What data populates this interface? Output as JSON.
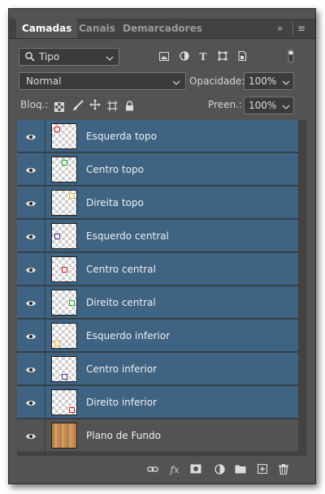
{
  "tabs": [
    {
      "label": "Camadas",
      "active": true
    },
    {
      "label": "Canais",
      "active": false
    },
    {
      "label": "Demarcadores",
      "active": false
    }
  ],
  "tab_icons": {
    "collapse": "»",
    "menu": "≡"
  },
  "filter": {
    "label": "Tipo"
  },
  "blend": {
    "mode": "Normal",
    "opacity_label": "Opacidade:",
    "opacity": "100%"
  },
  "lock": {
    "label": "Bloq.:",
    "fill_label": "Preen.:",
    "fill": "100%"
  },
  "layers": [
    {
      "name": "Esquerda topo",
      "color": "#e02020",
      "pos": "top-left",
      "selected": true
    },
    {
      "name": "Centro topo",
      "color": "#22aa22",
      "pos": "top-center",
      "selected": true
    },
    {
      "name": "Direita topo",
      "color": "#f0b030",
      "pos": "top-right",
      "selected": true
    },
    {
      "name": "Esquerdo central",
      "color": "#503090",
      "pos": "middle-left",
      "selected": true
    },
    {
      "name": "Centro central",
      "color": "#e02020",
      "pos": "middle-center",
      "selected": true
    },
    {
      "name": "Direito central",
      "color": "#22aa22",
      "pos": "middle-right",
      "selected": true
    },
    {
      "name": "Esquerdo inferior",
      "color": "#f0b030",
      "pos": "bottom-left",
      "selected": true
    },
    {
      "name": "Centro inferior",
      "color": "#503090",
      "pos": "bottom-center",
      "selected": true
    },
    {
      "name": "Direito inferior",
      "color": "#e02020",
      "pos": "bottom-right",
      "selected": true
    },
    {
      "name": "Plano de Fundo",
      "color": "#c58c55",
      "pos": "full",
      "selected": false
    }
  ],
  "colors": {
    "panel": "#535353",
    "selected": "#3f6382",
    "dark": "#424242"
  }
}
